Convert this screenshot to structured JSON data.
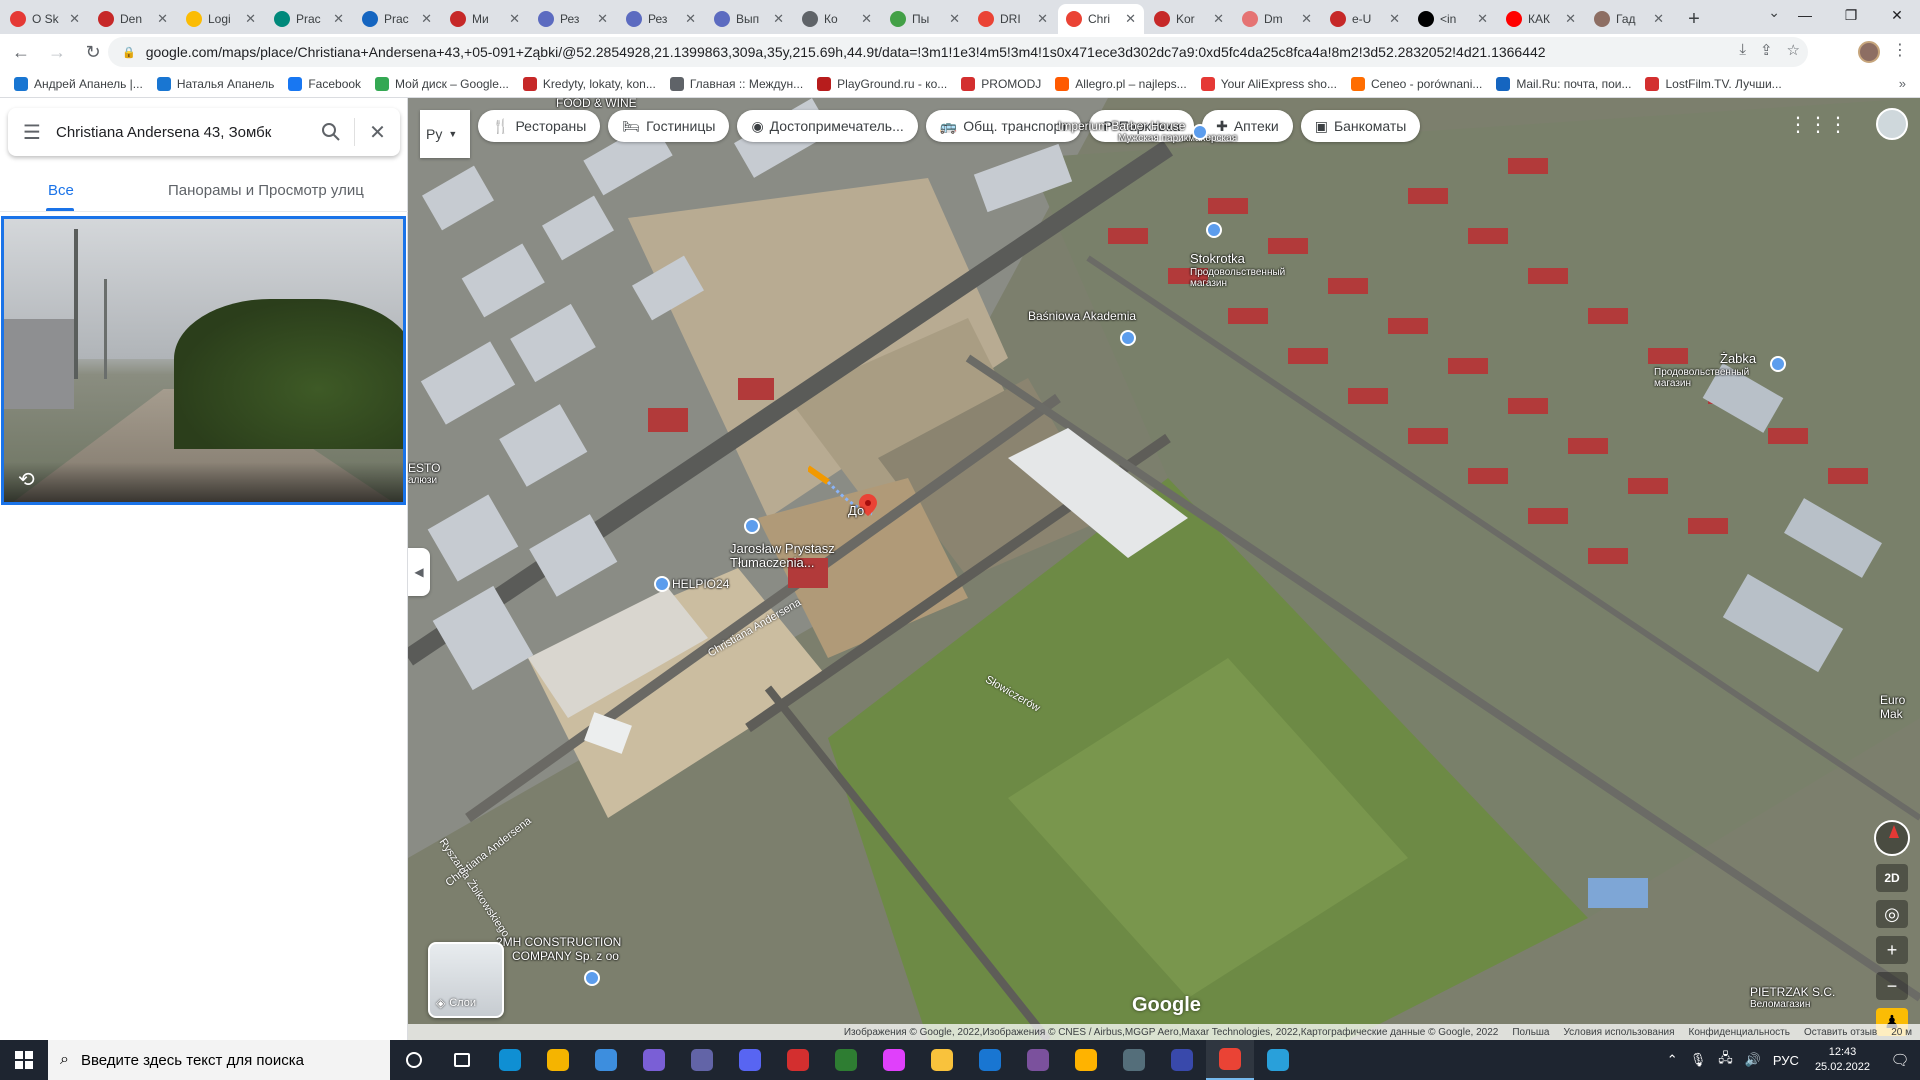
{
  "browser": {
    "tabs": [
      {
        "title": "О Sk",
        "color": "#e53935"
      },
      {
        "title": "Den",
        "color": "#c62828"
      },
      {
        "title": "Logi",
        "color": "#fbbc04"
      },
      {
        "title": "Prac",
        "color": "#00897b"
      },
      {
        "title": "Prac",
        "color": "#1565c0"
      },
      {
        "title": "Ми",
        "color": "#c62828"
      },
      {
        "title": "Рез",
        "color": "#5c6bc0"
      },
      {
        "title": "Рез",
        "color": "#5c6bc0"
      },
      {
        "title": "Вып",
        "color": "#5c6bc0"
      },
      {
        "title": "Ко",
        "color": "#5f6368"
      },
      {
        "title": "Пы",
        "color": "#43a047"
      },
      {
        "title": "DRI",
        "color": "#ea4335"
      },
      {
        "title": "Chri",
        "color": "#ea4335",
        "active": true
      },
      {
        "title": "Kor",
        "color": "#c62828"
      },
      {
        "title": "Dm",
        "color": "#e57373"
      },
      {
        "title": "e-U",
        "color": "#c62828"
      },
      {
        "title": "<in",
        "color": "#000000"
      },
      {
        "title": "КАК",
        "color": "#ff0000"
      },
      {
        "title": "Гад",
        "color": "#8d6e63"
      }
    ],
    "new_tab": "+",
    "url": "google.com/maps/place/Christiana+Andersena+43,+05-091+Ząbki/@52.2854928,21.1399863,309a,35y,215.69h,44.9t/data=!3m1!1e3!4m5!3m4!1s0x471ece3d302dc7a9:0xd5fc4da25c8fca4a!8m2!3d52.2832052!4d21.1366442",
    "bookmarks": [
      {
        "label": "Андрей Апанель |...",
        "color": "#1976d2"
      },
      {
        "label": "Наталья Апанель",
        "color": "#1976d2"
      },
      {
        "label": "Facebook",
        "color": "#1877f2"
      },
      {
        "label": "Мой диск – Google...",
        "color": "#34a853"
      },
      {
        "label": "Kredyty, lokaty, kon...",
        "color": "#c62828"
      },
      {
        "label": "Главная :: Междун...",
        "color": "#5f6368"
      },
      {
        "label": "PlayGround.ru - ко...",
        "color": "#b71c1c"
      },
      {
        "label": "PROMODJ",
        "color": "#d32f2f"
      },
      {
        "label": "Allegro.pl – najleps...",
        "color": "#ff5a00"
      },
      {
        "label": "Your AliExpress sho...",
        "color": "#e53935"
      },
      {
        "label": "Ceneo - porównani...",
        "color": "#ff6d00"
      },
      {
        "label": "Mail.Ru: почта, пои...",
        "color": "#1565c0"
      },
      {
        "label": "LostFilm.TV. Лучши...",
        "color": "#d32f2f"
      }
    ]
  },
  "maps": {
    "search_value": "Christiana Andersena 43, Зомбк",
    "tabs": {
      "all": "Все",
      "panoramas": "Панорамы и Просмотр улиц"
    },
    "layer_select": "Ру",
    "chips": [
      {
        "label": "Рестораны",
        "icon": "fork-knife-icon",
        "glyph": "🍴"
      },
      {
        "label": "Гостиницы",
        "icon": "bed-icon",
        "glyph": "🛏"
      },
      {
        "label": "Достопримечатель...",
        "icon": "camera-icon",
        "glyph": "◉"
      },
      {
        "label": "Общ. транспорт",
        "icon": "bus-icon",
        "glyph": "🚌"
      },
      {
        "label": "Парковка",
        "icon": "parking-icon",
        "glyph": "P"
      },
      {
        "label": "Аптеки",
        "icon": "pharmacy-icon",
        "glyph": "✚"
      },
      {
        "label": "Банкоматы",
        "icon": "atm-icon",
        "glyph": "▣"
      }
    ],
    "places": {
      "food_wine": "FOOD & WINE",
      "barber": "Imperium Barber House",
      "barber_sub": "Мужская парикмахерская",
      "stokrotka": "Stokrotka",
      "stokrotka_sub": "Продовольственный магазин",
      "basniowa": "Baśniowa Akademia",
      "zabka": "Żabka",
      "zabka_sub": "Продовольственный магазин",
      "esto": "ESTO",
      "esto_sub": "алюзи",
      "prystasz": "Jarosław Prystasz",
      "prystasz_sub": "Tłumaczenia...",
      "helpio": "HELPIO24",
      "pin_label": "До",
      "construction": "2MH CONSTRUCTION",
      "construction_sub": "COMPANY Sp. z oo",
      "pietrzak": "PIETRZAK S.C.",
      "pietrzak_sub": "Веломагазин",
      "euro": "Euro",
      "euro_sub": "Mak"
    },
    "streets": {
      "andersena1": "Christiana Andersena",
      "andersena2": "Christiana Andersena",
      "zbikowskiego": "Ryszarda Żbikowskiego",
      "slowiczerow": "Słowiczerów"
    },
    "layers_label": "Слои",
    "google": "Google",
    "btn_2d": "2D",
    "attribution": "Изображения © Google, 2022,Изображения © CNES / Airbus,MGGP Aero,Maxar Technologies, 2022,Картографические данные © Google, 2022",
    "links": [
      "Польша",
      "Условия использования",
      "Конфиденциальность",
      "Оставить отзыв"
    ],
    "scale": "20 м"
  },
  "taskbar": {
    "search_placeholder": "Введите здесь текст для поиска",
    "apps": [
      {
        "name": "cortana-icon",
        "color": "#ffffff"
      },
      {
        "name": "task-view-icon",
        "color": "#ffffff"
      },
      {
        "name": "edge-icon",
        "color": "#0f8fd3"
      },
      {
        "name": "r-app-icon",
        "color": "#f5b400"
      },
      {
        "name": "explorer-photo-icon",
        "color": "#3d8ede"
      },
      {
        "name": "game-icon",
        "color": "#7a5fd6"
      },
      {
        "name": "visual-studio-icon",
        "color": "#6264a7"
      },
      {
        "name": "discord-icon",
        "color": "#5865f2"
      },
      {
        "name": "red-app-icon",
        "color": "#d32f2f"
      },
      {
        "name": "utorrent-icon",
        "color": "#2e7d32"
      },
      {
        "name": "itunes-icon",
        "color": "#e040fb"
      },
      {
        "name": "file-explorer-icon",
        "color": "#f9c23c"
      },
      {
        "name": "mail-icon",
        "color": "#1976d2"
      },
      {
        "name": "viber-icon",
        "color": "#7b519d"
      },
      {
        "name": "warning-app-icon",
        "color": "#ffb300"
      },
      {
        "name": "calculator-icon",
        "color": "#546e7a"
      },
      {
        "name": "save-app-icon",
        "color": "#3949ab"
      },
      {
        "name": "chrome-icon",
        "color": "#ea4335",
        "active": true
      },
      {
        "name": "telegram-icon",
        "color": "#29a0da"
      }
    ],
    "lang": "РУС",
    "time": "12:43",
    "date": "25.02.2022"
  }
}
